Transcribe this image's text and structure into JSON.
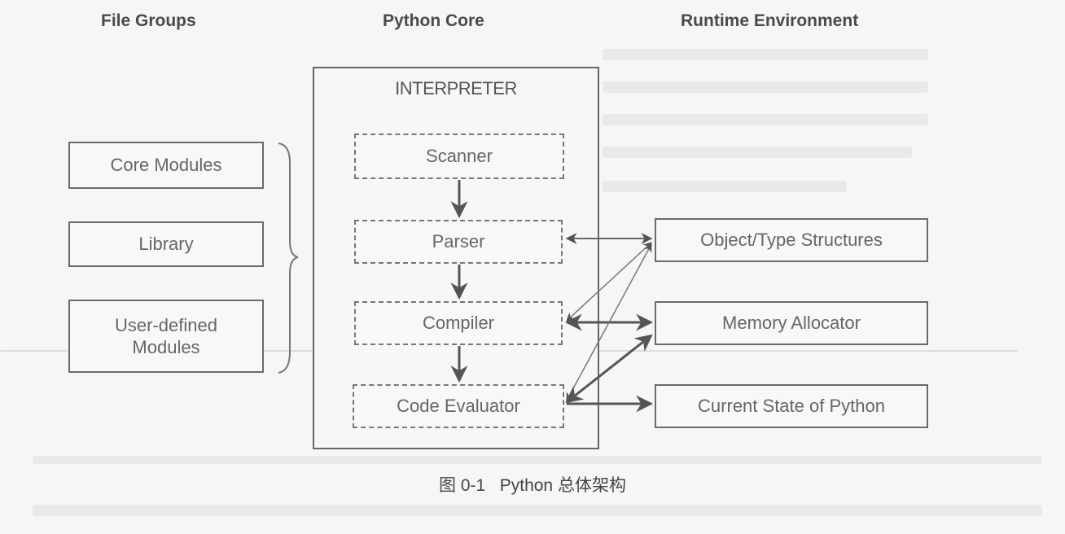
{
  "headers": {
    "file_groups": "File Groups",
    "python_core": "Python Core",
    "runtime_environment": "Runtime Environment"
  },
  "file_groups": [
    {
      "label": "Core Modules"
    },
    {
      "label": "Library"
    },
    {
      "label": "User-defined\nModules"
    }
  ],
  "interpreter": {
    "title": "INTERPRETER",
    "stages": [
      {
        "label": "Scanner"
      },
      {
        "label": "Parser"
      },
      {
        "label": "Compiler"
      },
      {
        "label": "Code Evaluator"
      }
    ]
  },
  "runtime": [
    {
      "label": "Object/Type Structures"
    },
    {
      "label": "Memory Allocator"
    },
    {
      "label": "Current State of Python"
    }
  ],
  "connections": [
    {
      "from": "Scanner",
      "to": "Parser",
      "type": "flow"
    },
    {
      "from": "Parser",
      "to": "Compiler",
      "type": "flow"
    },
    {
      "from": "Compiler",
      "to": "Code Evaluator",
      "type": "flow"
    },
    {
      "from": "Parser",
      "to": "Object/Type Structures",
      "type": "bidirectional"
    },
    {
      "from": "Compiler",
      "to": "Object/Type Structures",
      "type": "bidirectional"
    },
    {
      "from": "Compiler",
      "to": "Memory Allocator",
      "type": "bidirectional"
    },
    {
      "from": "Code Evaluator",
      "to": "Object/Type Structures",
      "type": "bidirectional"
    },
    {
      "from": "Code Evaluator",
      "to": "Memory Allocator",
      "type": "bidirectional"
    },
    {
      "from": "Code Evaluator",
      "to": "Current State of Python",
      "type": "directed"
    }
  ],
  "caption": "图 0-1   Python 总体架构"
}
